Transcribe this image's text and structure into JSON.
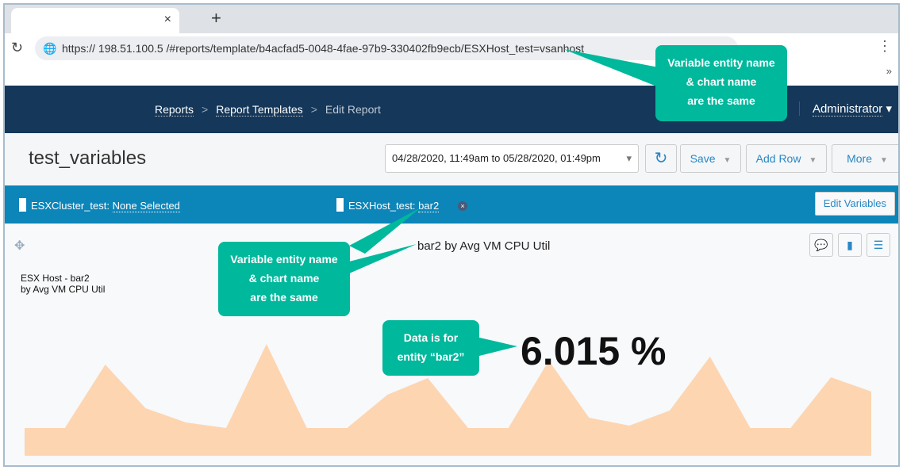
{
  "browser": {
    "url": "https:// 198.51.100.5 /#reports/template/b4acfad5-0048-4fae-97b9-330402fb9ecb/ESXHost_test=vsanhost",
    "close": "×",
    "new_tab": "+",
    "reload": "↻",
    "menu": "⋮",
    "overflow": "»"
  },
  "nav": {
    "breadcrumbs": [
      "Reports",
      "Report Templates",
      "Edit Report"
    ],
    "separator": ">",
    "user": "Administrator"
  },
  "toolbar": {
    "title": "test_variables",
    "date_range": "04/28/2020, 11:49am to 05/28/2020, 01:49pm",
    "refresh": "↻",
    "save": "Save",
    "add_row": "Add Row",
    "more": "More"
  },
  "variables": {
    "cluster_label": "ESXCluster_test:",
    "cluster_value": "None Selected",
    "host_label": "ESXHost_test:",
    "host_value": "bar2",
    "remove": "×",
    "edit": "Edit Variables"
  },
  "widget": {
    "label_line1": "ESX Host - bar2",
    "label_line2": "by Avg VM CPU Util",
    "chart_title": "bar2 by Avg VM CPU Util",
    "value": "6.015 %"
  },
  "callouts": {
    "top": [
      "Variable entity name",
      "& chart name",
      "are the same"
    ],
    "middle": [
      "Variable entity name",
      "& chart name",
      "are the same"
    ],
    "data": [
      "Data is for",
      "entity “bar2”"
    ]
  },
  "colors": {
    "nav": "#14375a",
    "varbar": "#0c85b9",
    "callout": "#00b89c",
    "spark": "#fdd5b1"
  },
  "chart_data": {
    "type": "area",
    "values": [
      35,
      35,
      115,
      60,
      42,
      35,
      141,
      35,
      35,
      77,
      98,
      35,
      35,
      120,
      48,
      38,
      57,
      125,
      35,
      35,
      99,
      81
    ]
  }
}
